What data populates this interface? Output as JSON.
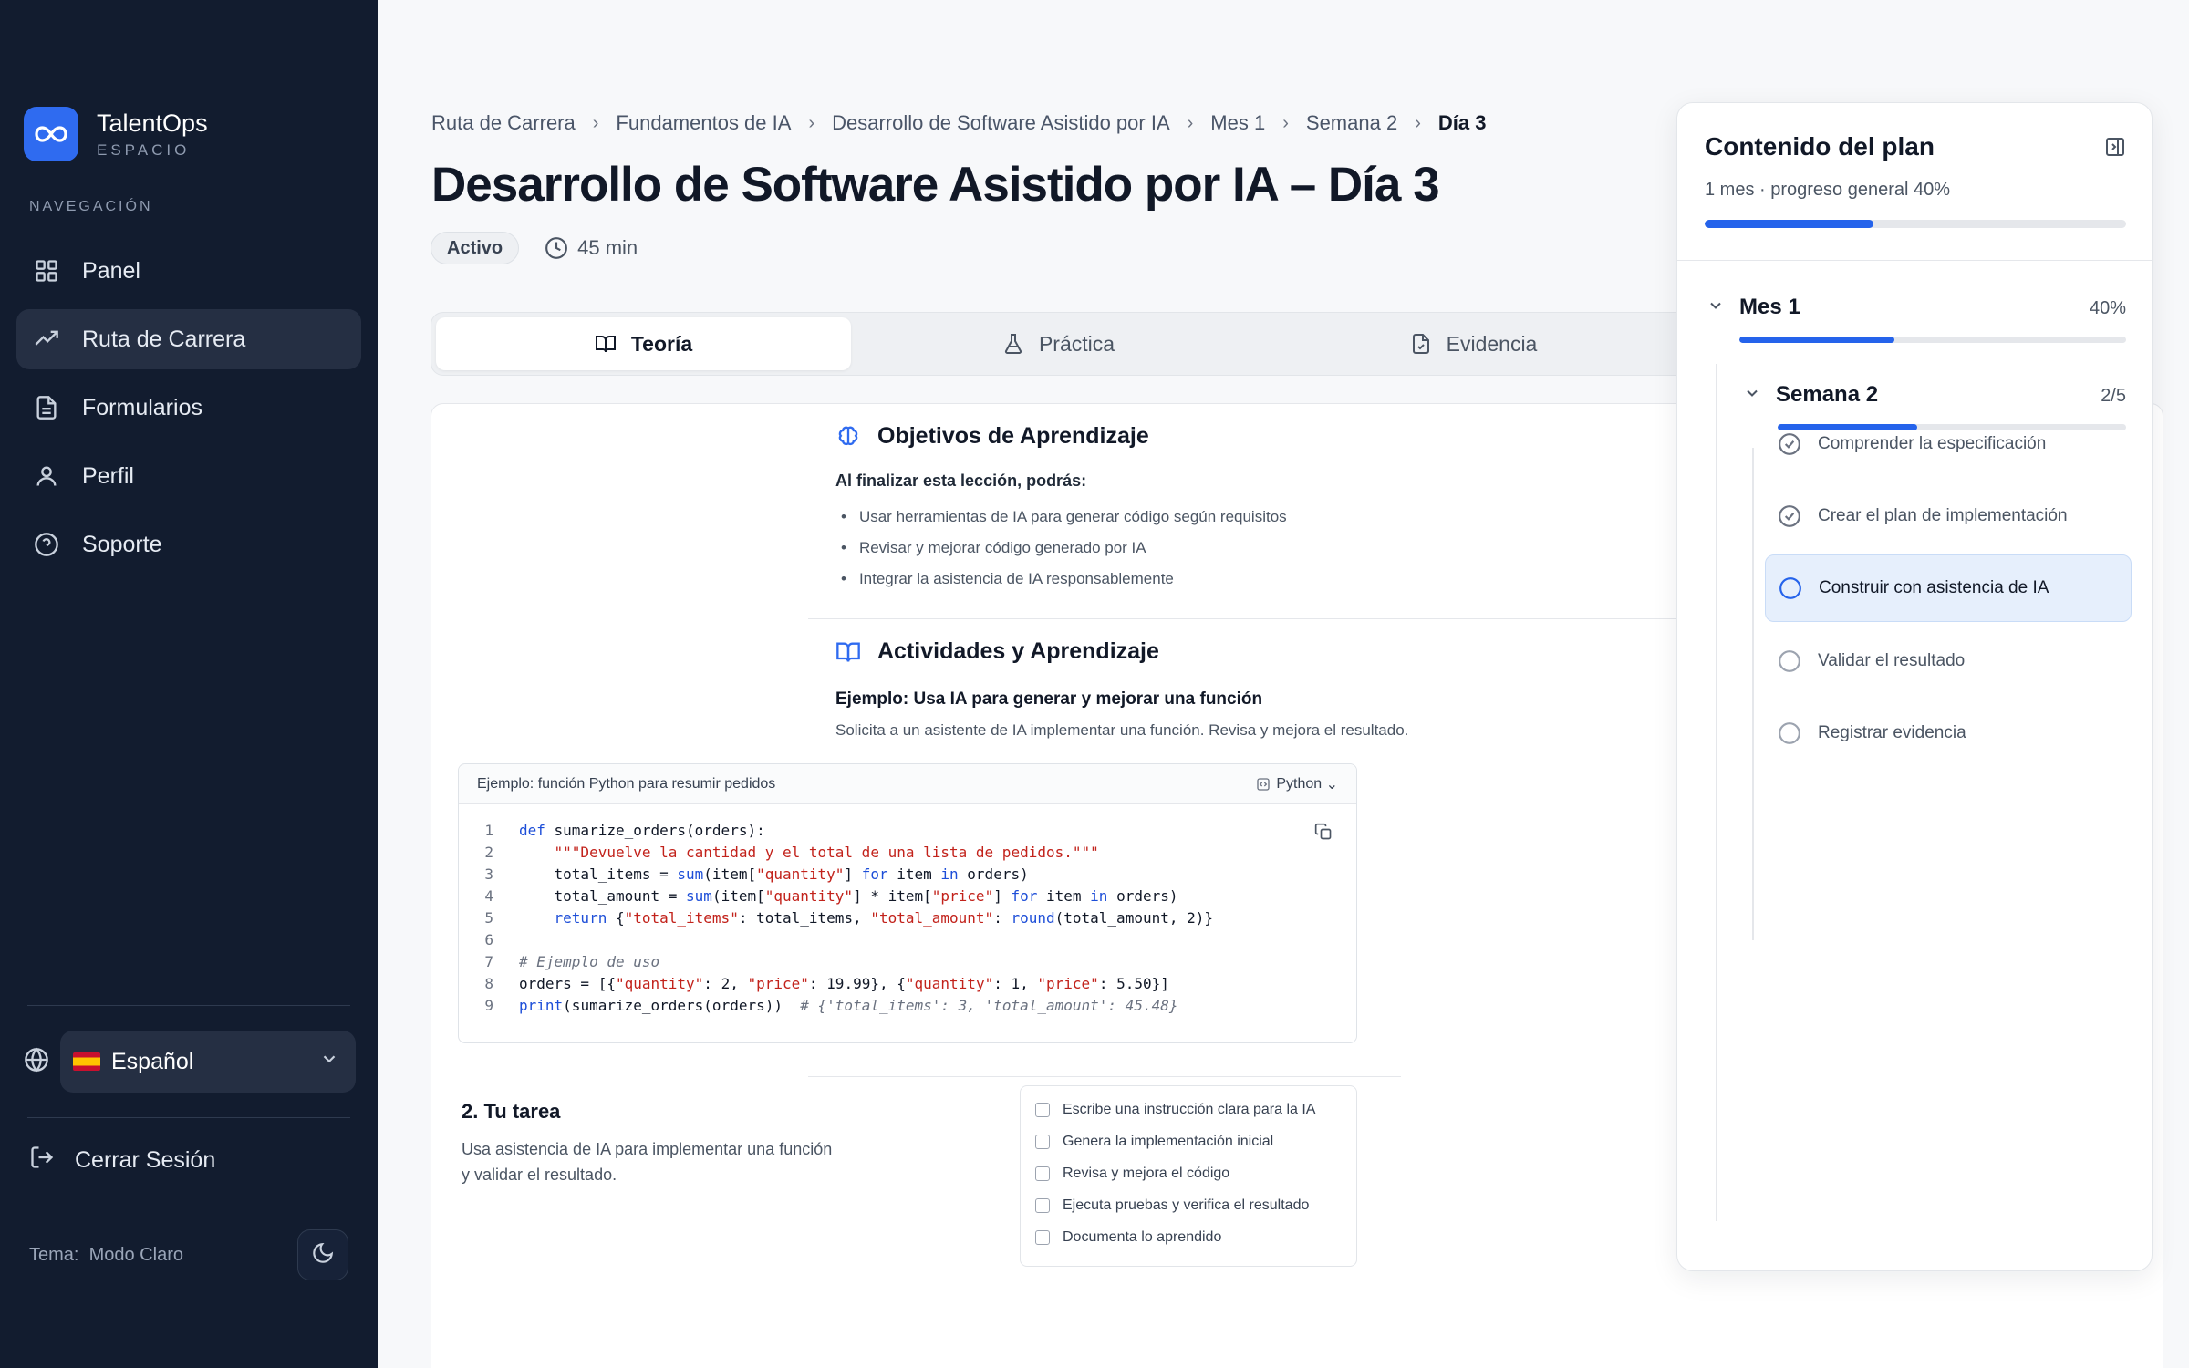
{
  "brand": {
    "name": "TalentOps",
    "subtitle": "ESPACIO",
    "accent": "#2f6bf0"
  },
  "sidebar": {
    "heading": "NAVEGACIÓN",
    "items": [
      {
        "label": "Panel",
        "icon": "grid-icon",
        "active": false
      },
      {
        "label": "Ruta de Carrera",
        "icon": "trending-up-icon",
        "active": true
      },
      {
        "label": "Formularios",
        "icon": "document-icon",
        "active": false
      },
      {
        "label": "Perfil",
        "icon": "user-icon",
        "active": false
      },
      {
        "label": "Soporte",
        "icon": "help-circle-icon",
        "active": false
      }
    ],
    "language": "Español",
    "logout": "Cerrar Sesión",
    "theme_label": "Tema:",
    "theme_value": "Modo Claro"
  },
  "breadcrumb": [
    "Ruta de Carrera",
    "Fundamentos de IA",
    "Desarrollo de Software Asistido por IA",
    "Mes 1",
    "Semana 2",
    "Día 3"
  ],
  "page": {
    "title": "Desarrollo de Software Asistido por IA – Día 3",
    "status": "Activo",
    "duration": "45 min"
  },
  "tabs": [
    {
      "label": "Teoría",
      "icon": "book-open-icon",
      "active": true
    },
    {
      "label": "Práctica",
      "icon": "flask-icon",
      "active": false
    },
    {
      "label": "Evidencia",
      "icon": "file-check-icon",
      "active": false
    }
  ],
  "objectives": {
    "heading": "Objetivos de Aprendizaje",
    "intro": "Al finalizar esta lección, podrás:",
    "items": [
      "Usar herramientas de IA para generar código según requisitos",
      "Revisar y mejorar código generado por IA",
      "Integrar la asistencia de IA responsablemente"
    ]
  },
  "activities": {
    "heading": "Actividades y Aprendizaje",
    "example_title": "Ejemplo: Usa IA para generar y mejorar una función",
    "example_desc": "Solicita a un asistente de IA implementar una función. Revisa y mejora el resultado.",
    "code": {
      "caption": "Ejemplo: función Python para resumir pedidos",
      "language": "Python",
      "lines": [
        [
          [
            "kw",
            "def "
          ],
          [
            "fn",
            "sumarize_orders(orders):"
          ]
        ],
        [
          [
            "plain",
            "    "
          ],
          [
            "str",
            "\"\"\"Devuelve la cantidad y el total de una lista de pedidos.\"\"\""
          ]
        ],
        [
          [
            "plain",
            "    total_items = "
          ],
          [
            "kw",
            "sum"
          ],
          [
            "plain",
            "(item["
          ],
          [
            "str",
            "\"quantity\""
          ],
          [
            "plain",
            "] "
          ],
          [
            "kw",
            "for"
          ],
          [
            "plain",
            " item "
          ],
          [
            "kw",
            "in"
          ],
          [
            "plain",
            " orders)"
          ]
        ],
        [
          [
            "plain",
            "    total_amount = "
          ],
          [
            "kw",
            "sum"
          ],
          [
            "plain",
            "(item["
          ],
          [
            "str",
            "\"quantity\""
          ],
          [
            "plain",
            "] * item["
          ],
          [
            "str",
            "\"price\""
          ],
          [
            "plain",
            "] "
          ],
          [
            "kw",
            "for"
          ],
          [
            "plain",
            " item "
          ],
          [
            "kw",
            "in"
          ],
          [
            "plain",
            " orders)"
          ]
        ],
        [
          [
            "plain",
            "    "
          ],
          [
            "kw",
            "return"
          ],
          [
            "plain",
            " {"
          ],
          [
            "str",
            "\"total_items\""
          ],
          [
            "plain",
            ": total_items, "
          ],
          [
            "str",
            "\"total_amount\""
          ],
          [
            "plain",
            ": "
          ],
          [
            "kw",
            "round"
          ],
          [
            "plain",
            "(total_amount, 2)}"
          ]
        ],
        [],
        [
          [
            "com",
            "# Ejemplo de uso"
          ]
        ],
        [
          [
            "plain",
            "orders = [{"
          ],
          [
            "str",
            "\"quantity\""
          ],
          [
            "plain",
            ": 2, "
          ],
          [
            "str",
            "\"price\""
          ],
          [
            "plain",
            ": 19.99}, {"
          ],
          [
            "str",
            "\"quantity\""
          ],
          [
            "plain",
            ": 1, "
          ],
          [
            "str",
            "\"price\""
          ],
          [
            "plain",
            ": 5.50}]"
          ]
        ],
        [
          [
            "kw",
            "print"
          ],
          [
            "plain",
            "(sumarize_orders(orders))  "
          ],
          [
            "com",
            "# {'total_items': 3, 'total_amount': 45.48}"
          ]
        ]
      ]
    }
  },
  "task": {
    "title": "2. Tu tarea",
    "desc_line1": "Usa asistencia de IA para implementar una función",
    "desc_line2": "y validar el resultado.",
    "checklist": [
      "Escribe una instrucción clara para la IA",
      "Genera la implementación inicial",
      "Revisa y mejora el código",
      "Ejecuta pruebas y verifica el resultado",
      "Documenta lo aprendido"
    ]
  },
  "plan": {
    "title": "Contenido del plan",
    "subtitle": "1 mes · progreso general 40%",
    "overall_progress": 0.4,
    "month": {
      "label": "Mes 1",
      "percent": "40%",
      "progress": 0.4
    },
    "week": {
      "label": "Semana 2",
      "count": "2/5",
      "progress": 0.4
    },
    "steps": [
      {
        "label": "Comprender la especificación",
        "state": "done"
      },
      {
        "label": "Crear el plan de implementación",
        "state": "done"
      },
      {
        "label": "Construir con asistencia de IA",
        "state": "current"
      },
      {
        "label": "Validar el resultado",
        "state": "todo"
      },
      {
        "label": "Registrar evidencia",
        "state": "todo"
      }
    ]
  }
}
